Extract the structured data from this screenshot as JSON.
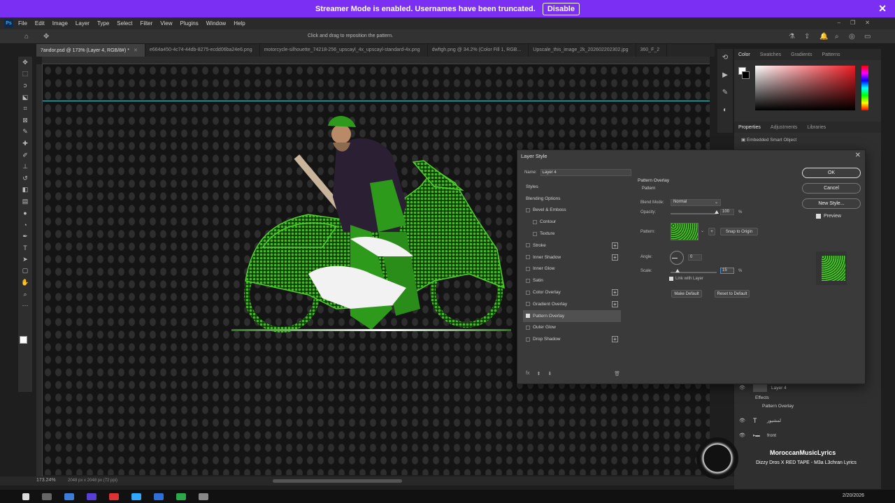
{
  "banner": {
    "message": "Streamer Mode is enabled. Usernames have been truncated.",
    "disable_label": "Disable"
  },
  "menu": {
    "items": [
      "File",
      "Edit",
      "Image",
      "Layer",
      "Type",
      "Select",
      "Filter",
      "View",
      "Plugins",
      "Window",
      "Help"
    ]
  },
  "options": {
    "hint": "Click and drag to reposition the pattern."
  },
  "tabs": [
    {
      "label": "7andor.psd @ 173% (Layer 4, RGB/8#) *"
    },
    {
      "label": "e664a450-4c74-44db-8275-ecdd06ba24e6.png"
    },
    {
      "label": "motorcycle-silhouette_74218-256_upscayl_4x_upscayl-standard-4x.png"
    },
    {
      "label": "dwftgh.png @ 34.2% (Color Fill 1, RGB..."
    },
    {
      "label": "Upscale_this_image_2k_202602202302.jpg"
    },
    {
      "label": "360_F_2"
    }
  ],
  "status": {
    "zoom": "173.24%",
    "dims": "2048 px x 2048 px (72 ppi)"
  },
  "panels": {
    "color_tabs": [
      "Color",
      "Swatches",
      "Gradients",
      "Patterns"
    ],
    "props_tabs": [
      "Properties",
      "Adjustments",
      "Libraries"
    ],
    "props_item": "Embedded Smart Object"
  },
  "layers": {
    "rows": [
      {
        "label": "Layer 4"
      },
      {
        "label": "Effects"
      },
      {
        "label": "Pattern Overlay"
      },
      {
        "label": "لمشيور"
      },
      {
        "label": "front"
      }
    ]
  },
  "dialog": {
    "title": "Layer Style",
    "name_label": "Name:",
    "name_value": "Layer 4",
    "styles_header": "Styles",
    "blending_options": "Blending Options",
    "styles": [
      {
        "label": "Bevel & Emboss",
        "checked": false,
        "plus": false,
        "sub": false
      },
      {
        "label": "Contour",
        "checked": false,
        "plus": false,
        "sub": true
      },
      {
        "label": "Texture",
        "checked": false,
        "plus": false,
        "sub": true
      },
      {
        "label": "Stroke",
        "checked": false,
        "plus": true,
        "sub": false
      },
      {
        "label": "Inner Shadow",
        "checked": false,
        "plus": true,
        "sub": false
      },
      {
        "label": "Inner Glow",
        "checked": false,
        "plus": false,
        "sub": false
      },
      {
        "label": "Satin",
        "checked": false,
        "plus": false,
        "sub": false
      },
      {
        "label": "Color Overlay",
        "checked": false,
        "plus": true,
        "sub": false
      },
      {
        "label": "Gradient Overlay",
        "checked": false,
        "plus": true,
        "sub": false
      },
      {
        "label": "Pattern Overlay",
        "checked": true,
        "plus": false,
        "sub": false,
        "selected": true
      },
      {
        "label": "Outer Glow",
        "checked": false,
        "plus": false,
        "sub": false
      },
      {
        "label": "Drop Shadow",
        "checked": false,
        "plus": true,
        "sub": false
      }
    ],
    "fx_label": "fx",
    "pane": {
      "title": "Pattern Overlay",
      "subtitle": "Pattern",
      "blend_label": "Blend Mode:",
      "blend_value": "Normal",
      "opacity_label": "Opacity:",
      "opacity_value": "100",
      "opacity_level": 1.0,
      "pattern_label": "Pattern:",
      "snap_label": "Snap to Origin",
      "angle_label": "Angle:",
      "angle_value": "0",
      "scale_label": "Scale:",
      "scale_value": "15",
      "scale_level": 0.15,
      "percent": "%",
      "link_label": "Link with Layer",
      "make_default": "Make Default",
      "reset_default": "Reset to Default"
    },
    "ok": "OK",
    "cancel": "Cancel",
    "new_style": "New Style...",
    "preview": "Preview"
  },
  "overlay": {
    "channel": "MoroccanMusicLyrics",
    "song": "Dizzy Dros X RED TAPE - M3a L3chran Lyrics"
  },
  "taskbar": {
    "date": "2/20/2026"
  },
  "colors": {
    "banner": "#7b2ff2",
    "accent_green": "#3fbf1f",
    "guide": "#4bd0d0"
  }
}
